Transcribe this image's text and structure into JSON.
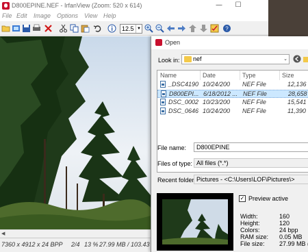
{
  "window": {
    "title": "D800EPINE.NEF - IrfanView (Zoom: 520 x 614)",
    "min_glyph": "—",
    "max_glyph": "☐"
  },
  "menu": [
    "File",
    "Edit",
    "Image",
    "Options",
    "View",
    "Help"
  ],
  "toolbar": {
    "zoom_value": "12.5",
    "icons": [
      "open-icon",
      "slideshow-icon",
      "save-icon",
      "print-icon",
      "delete-icon",
      "cut-icon",
      "copy-icon",
      "paste-icon",
      "undo-icon",
      "info-icon",
      "zoom-in-icon",
      "zoom-out-icon",
      "previous-icon",
      "next-icon",
      "first-icon",
      "last-icon",
      "effects-icon",
      "help-icon"
    ]
  },
  "status": {
    "dims": "7360 x 4912 x 24 BPP",
    "index": "2/4",
    "zoom": "13 %",
    "size": "27.99 MB / 103.43 M"
  },
  "dialog": {
    "title": "Open",
    "look_in_label": "Look in:",
    "look_in_value": "nef",
    "columns": [
      "Name",
      "Date",
      "Type",
      "Size"
    ],
    "files": [
      {
        "name": "_DSC4190",
        "date": "10/24/200",
        "type": "NEF File",
        "size": "12,136"
      },
      {
        "name": "D800EPI...",
        "date": "6/18/2012 ...",
        "type": "NEF File",
        "size": "28,658"
      },
      {
        "name": "DSC_0002",
        "date": "10/23/200",
        "type": "NEF File",
        "size": "15,541"
      },
      {
        "name": "DSC_0646",
        "date": "10/24/200",
        "type": "NEF File",
        "size": "11,390"
      }
    ],
    "file_name_label": "File name:",
    "file_name_value": "D800EPINE",
    "file_type_label": "Files of type:",
    "file_type_value": "All files (*.*)",
    "recent_label": "Recent folders:",
    "recent_value": "Pictures  -  <C:\\Users\\LOF\\Pictures\\>",
    "preview_active_label": "Preview active",
    "preview_checked_glyph": "✓",
    "info": [
      {
        "label": "Width:",
        "value": "160"
      },
      {
        "label": "Height:",
        "value": "120"
      },
      {
        "label": "Colors:",
        "value": "24 bpp"
      },
      {
        "label": "RAM size:",
        "value": "0.05 MB"
      },
      {
        "label": "File size:",
        "value": "27.99 MB (28"
      }
    ]
  },
  "colors": {
    "selection": "#cce8ff",
    "accent_red": "#c8102e",
    "folder_yellow": "#f3c94a"
  }
}
